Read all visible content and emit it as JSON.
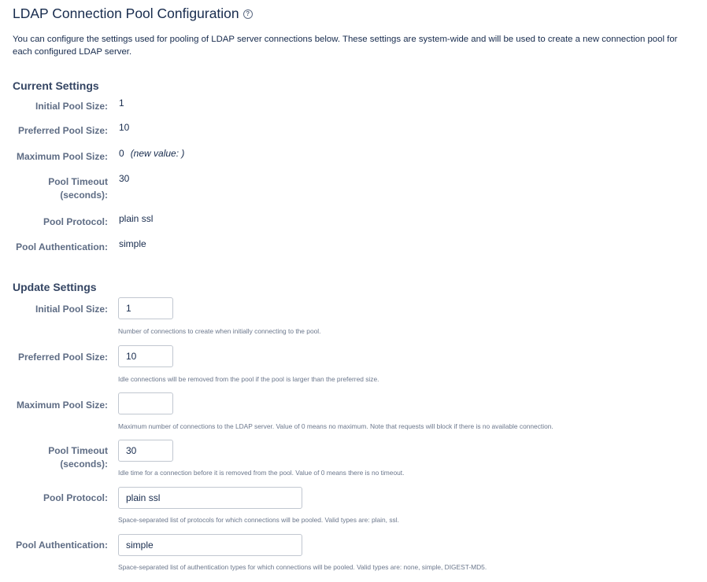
{
  "page": {
    "title": "LDAP Connection Pool Configuration",
    "help_icon": "question-circle-icon",
    "intro": "You can configure the settings used for pooling of LDAP server connections below. These settings are system-wide and will be used to create a new connection pool for each configured LDAP server."
  },
  "current": {
    "heading": "Current Settings",
    "initial": {
      "label": "Initial Pool Size:",
      "value": "1"
    },
    "preferred": {
      "label": "Preferred Pool Size:",
      "value": "10"
    },
    "maximum": {
      "label": "Maximum Pool Size:",
      "value": "0",
      "note": "(new value: )"
    },
    "timeout": {
      "label_1": "Pool Timeout",
      "label_2": "(seconds):",
      "value": "30"
    },
    "protocol": {
      "label": "Pool Protocol:",
      "value": "plain ssl"
    },
    "auth": {
      "label": "Pool Authentication:",
      "value": "simple"
    }
  },
  "update": {
    "heading": "Update Settings",
    "initial": {
      "label": "Initial Pool Size:",
      "value": "1",
      "desc": "Number of connections to create when initially connecting to the pool."
    },
    "preferred": {
      "label": "Preferred Pool Size:",
      "value": "10",
      "desc": "Idle connections will be removed from the pool if the pool is larger than the preferred size."
    },
    "maximum": {
      "label": "Maximum Pool Size:",
      "value": "",
      "desc": "Maximum number of connections to the LDAP server. Value of 0 means no maximum. Note that requests will block if there is no available connection."
    },
    "timeout": {
      "label_1": "Pool Timeout",
      "label_2": "(seconds):",
      "value": "30",
      "desc": "Idle time for a connection before it is removed from the pool. Value of 0 means there is no timeout."
    },
    "protocol": {
      "label": "Pool Protocol:",
      "value": "plain ssl",
      "desc": "Space-separated list of protocols for which connections will be pooled. Valid types are: plain, ssl."
    },
    "auth": {
      "label": "Pool Authentication:",
      "value": "simple",
      "desc": "Space-separated list of authentication types for which connections will be pooled. Valid types are: none, simple, DIGEST-MD5."
    }
  }
}
